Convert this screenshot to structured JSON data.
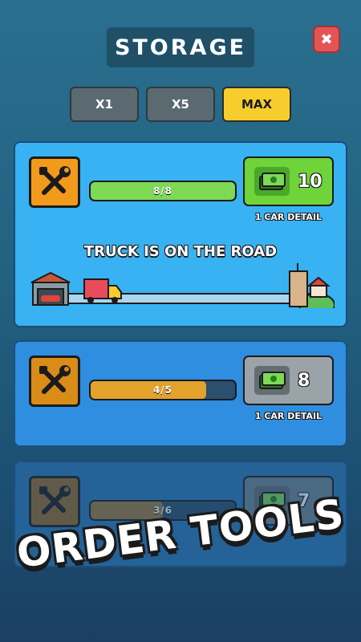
{
  "header": {
    "title": "STORAGE",
    "close_label": "✖"
  },
  "multipliers": [
    {
      "label": "X1",
      "active": false
    },
    {
      "label": "X5",
      "active": false
    },
    {
      "label": "MAX",
      "active": true
    }
  ],
  "tools": [
    {
      "progress_text": "8/8",
      "progress_fraction": 1.0,
      "price": "10",
      "detail": "1 CAR DETAIL",
      "status": "TRUCK IS ON THE ROAD",
      "fill_color": "#7ed957"
    },
    {
      "progress_text": "4/5",
      "progress_fraction": 0.8,
      "price": "8",
      "detail": "1 CAR DETAIL"
    },
    {
      "progress_text": "3/6",
      "progress_fraction": 0.5,
      "price": "7"
    }
  ],
  "promo_text": "ORDER TOOLS",
  "colors": {
    "accent_yellow": "#f7cd2e",
    "tool_orange": "#f29a1b",
    "buy_green": "#6ed43a",
    "bar_orange": "#e3a22c"
  }
}
